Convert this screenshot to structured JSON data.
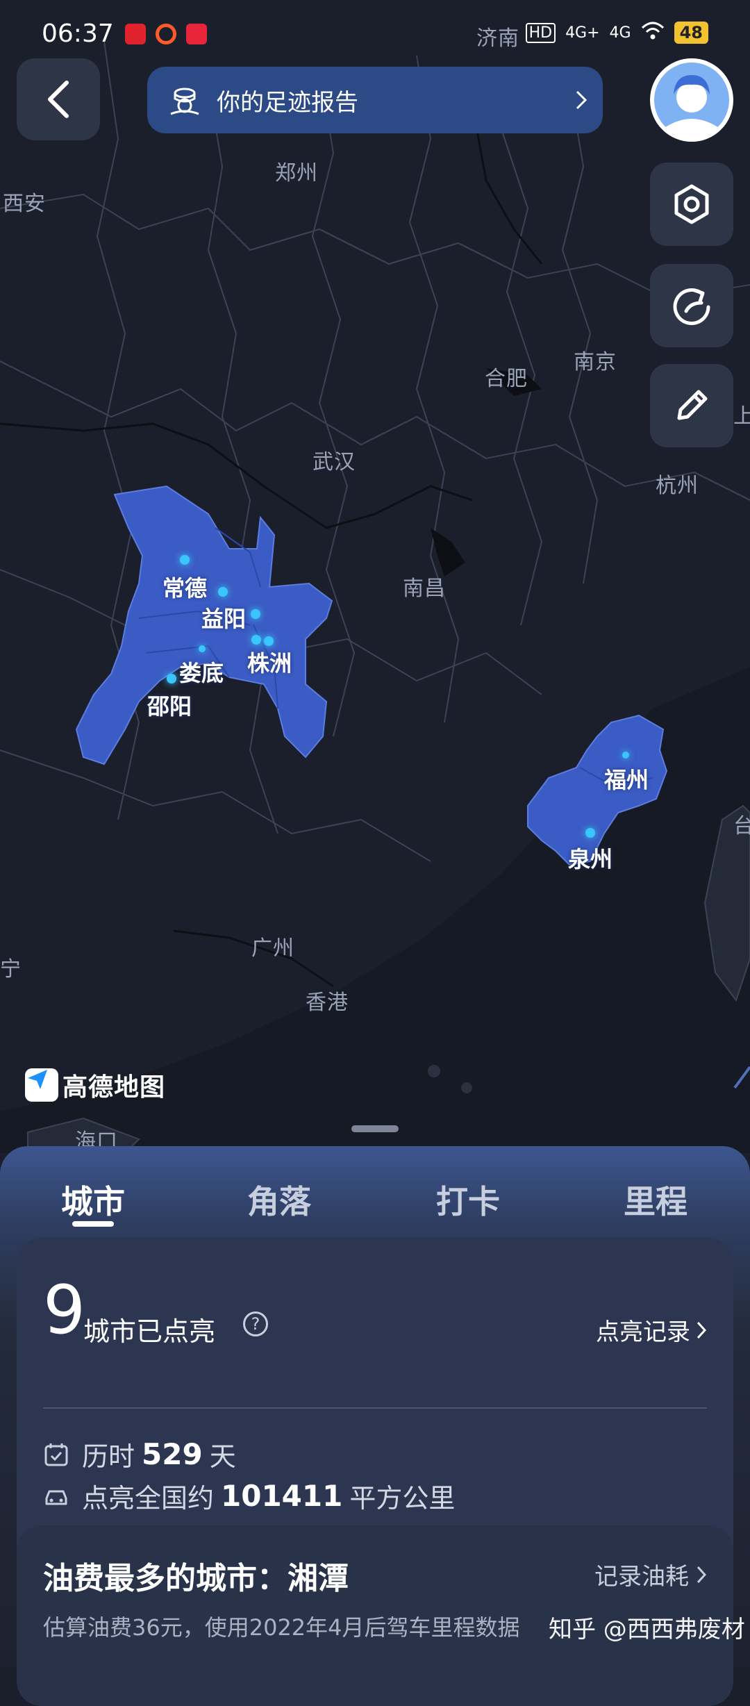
{
  "status_bar": {
    "time": "06:37",
    "right_indicators": [
      "HD",
      "4G+",
      "4G",
      "wifi"
    ],
    "battery": "48"
  },
  "header": {
    "report_label": "你的足迹报告"
  },
  "map": {
    "place_labels": [
      "济南",
      "郑州",
      "西安",
      "合肥",
      "南京",
      "上",
      "武汉",
      "杭州",
      "南昌",
      "台",
      "宁",
      "广州",
      "香港",
      "海口"
    ],
    "lit_cities": [
      "常德",
      "益阳",
      "娄底",
      "株洲",
      "邵阳",
      "福州",
      "泉州"
    ],
    "brand": "高德地图"
  },
  "tabs": [
    "城市",
    "角落",
    "打卡",
    "里程"
  ],
  "active_tab": "城市",
  "summary": {
    "count": "9",
    "count_label": "城市已点亮",
    "help": "?",
    "record_link": "点亮记录",
    "days_prefix": "历时",
    "days_value": "529",
    "days_suffix": "天",
    "area_prefix": "点亮全国约",
    "area_value": "101411",
    "area_suffix": "平方公里"
  },
  "fuel": {
    "title": "油费最多的城市：湘潭",
    "link": "记录油耗",
    "desc": "估算油费36元，使用2022年4月后驾车里程数据"
  },
  "watermark": "知乎 @西西弗废材",
  "colors": {
    "map_bg": "#1b1f2c",
    "lit_region": "#3a5cc4",
    "dot": "#39c6ff",
    "pill": "#2c4a86",
    "card": "#2c3650"
  }
}
